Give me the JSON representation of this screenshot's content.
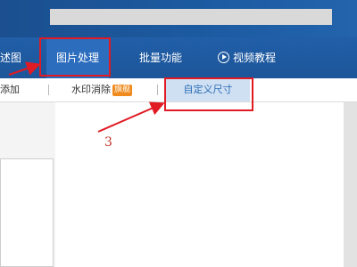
{
  "nav": {
    "tab_partial": "述图",
    "tab_image_processing": "图片处理",
    "tab_batch": "批量功能",
    "tab_video_tutorial": "视频教程"
  },
  "subbar": {
    "item_partial": "添加",
    "item_watermark": "水印消除",
    "item_watermark_badge": "旗舰",
    "item_custom_size": "自定义尺寸"
  },
  "annotation": {
    "step_number": "3",
    "highlight_color": "#e01b24"
  },
  "colors": {
    "nav_bg": "#1d5599",
    "accent_badge": "#f08a1c",
    "active_subtab": "#cfe0f3"
  }
}
